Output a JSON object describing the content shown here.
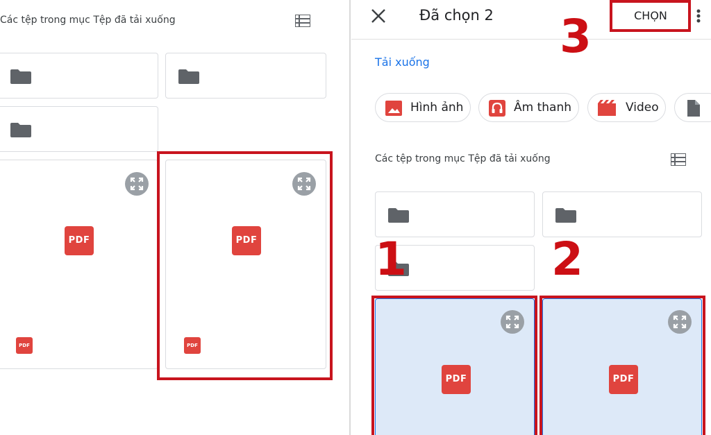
{
  "left": {
    "section_title": "Các tệp trong mục Tệp đã tải xuống",
    "file_labels": [
      "PDF",
      "PDF"
    ],
    "file_small_labels": [
      "PDF",
      "PDF"
    ]
  },
  "right": {
    "header": {
      "title": "Đã chọn 2",
      "select_label": "CHỌN"
    },
    "breadcrumb": "Tải xuống",
    "chips": [
      {
        "label": "Hình ảnh",
        "icon": "image-icon",
        "color": "#e0443e"
      },
      {
        "label": "Âm thanh",
        "icon": "headphones-icon",
        "color": "#e0443e"
      },
      {
        "label": "Video",
        "icon": "video-icon",
        "color": "#e0443e"
      },
      {
        "label": "",
        "icon": "document-icon",
        "color": "#5f6368"
      }
    ],
    "section_title": "Các tệp trong mục Tệp đã tải xuống",
    "file_labels": [
      "PDF",
      "PDF"
    ]
  },
  "annotations": {
    "step_1": "1",
    "step_2": "2",
    "step_3": "3"
  },
  "colors": {
    "highlight_red": "#c8141e",
    "selected_bg": "#dde9f8",
    "pdf_red": "#e0443e",
    "link_blue": "#1a73e8"
  }
}
